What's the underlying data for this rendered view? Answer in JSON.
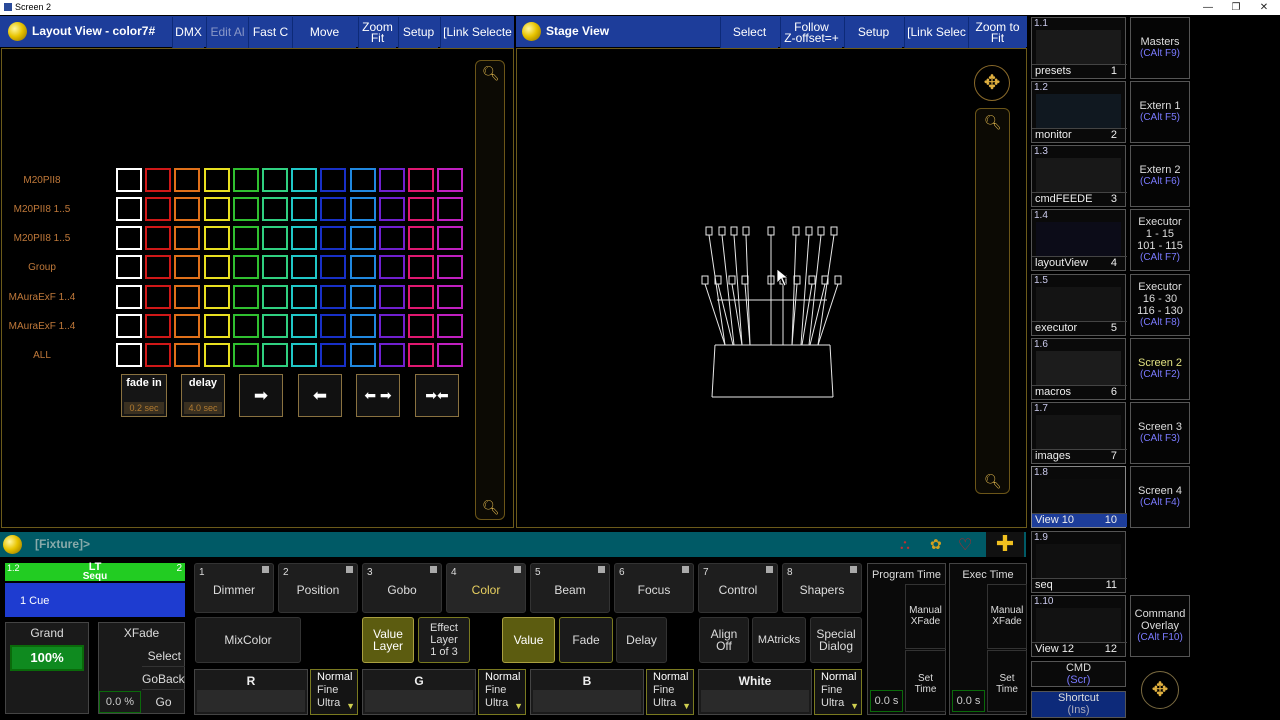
{
  "window": {
    "title": "Screen 2",
    "controls": [
      "—",
      "❐",
      "✕"
    ]
  },
  "layout_view": {
    "title": "Layout View - color7#",
    "buttons": [
      "DMX",
      "Edit Al",
      "Fast C",
      "Move",
      "Zoom\nFit",
      "Setup",
      "[Link Selecte"
    ],
    "row_labels": [
      "M20PII8",
      "M20PII8 1..5",
      "M20PII8 1..5",
      "Group",
      "MAuraExF 1..4",
      "MAuraExF 1..4",
      "ALL"
    ],
    "column_colors": [
      "#ffffff",
      "#d01818",
      "#e0701a",
      "#e8e020",
      "#30c030",
      "#30d080",
      "#20c8c8",
      "#1830c8",
      "#2088e0",
      "#7020d0",
      "#e01870",
      "#c020c0"
    ],
    "fade_label": "fade in",
    "fade_value": "0.2 sec",
    "delay_label": "delay",
    "delay_value": "4.0 sec",
    "arrows": [
      "➡",
      "⬅",
      "⬅ ➡",
      "➡⬅"
    ]
  },
  "stage_view": {
    "title": "Stage View",
    "buttons": [
      "Select",
      "Follow\nZ-offset=+",
      "Setup",
      "[Link Selec",
      "Zoom to\nFit"
    ]
  },
  "viewpool": [
    {
      "num": "1.1",
      "name": "presets",
      "idx": "1"
    },
    {
      "num": "1.2",
      "name": "monitor",
      "idx": "2"
    },
    {
      "num": "1.3",
      "name": "cmdFEEDE",
      "idx": "3"
    },
    {
      "num": "1.4",
      "name": "layoutView",
      "idx": "4"
    },
    {
      "num": "1.5",
      "name": "executor",
      "idx": "5"
    },
    {
      "num": "1.6",
      "name": "macros",
      "idx": "6"
    },
    {
      "num": "1.7",
      "name": "images",
      "idx": "7"
    },
    {
      "num": "1.8",
      "name": "View 10",
      "idx": "10"
    },
    {
      "num": "1.9",
      "name": "seq",
      "idx": "11"
    },
    {
      "num": "1.10",
      "name": "View 12",
      "idx": "12"
    }
  ],
  "cmd_btn": {
    "l1": "CMD",
    "l2": "(Scr)"
  },
  "shortcut_btn": {
    "l1": "Shortcut",
    "l2": "(Ins)"
  },
  "sidebar": [
    {
      "l1": "Masters",
      "l2": "",
      "key": "(CAlt F9)"
    },
    {
      "l1": "Extern 1",
      "l2": "",
      "key": "(CAlt F5)"
    },
    {
      "l1": "Extern 2",
      "l2": "",
      "key": "(CAlt F6)"
    },
    {
      "l1": "Executor",
      "l2": "1 - 15\n101 - 115",
      "key": "(CAlt F7)"
    },
    {
      "l1": "Executor",
      "l2": "16 - 30\n116 - 130",
      "key": "(CAlt F8)"
    },
    {
      "l1": "Screen 2",
      "l2": "",
      "key": "(CAlt F2)"
    },
    {
      "l1": "Screen 3",
      "l2": "",
      "key": "(CAlt F3)"
    },
    {
      "l1": "Screen 4",
      "l2": "",
      "key": "(CAlt F4)"
    }
  ],
  "command_overlay": {
    "l1": "Command\nOverlay",
    "key": "(CAlt F10)"
  },
  "fixture_bar": {
    "text": "[Fixture]>"
  },
  "executor": {
    "num": "1.2",
    "name": "LT",
    "sub": "Sequ",
    "page": "2",
    "cue": "1 Cue",
    "grand_label": "Grand",
    "grand_value": "100%",
    "xfade_label": "XFade",
    "xfade_value": "0.0 %",
    "select": "Select",
    "goback": "GoBack",
    "go": "Go"
  },
  "features": [
    {
      "n": "1",
      "t": "Dimmer"
    },
    {
      "n": "2",
      "t": "Position"
    },
    {
      "n": "3",
      "t": "Gobo"
    },
    {
      "n": "4",
      "t": "Color"
    },
    {
      "n": "5",
      "t": "Beam"
    },
    {
      "n": "6",
      "t": "Focus"
    },
    {
      "n": "7",
      "t": "Control"
    },
    {
      "n": "8",
      "t": "Shapers"
    }
  ],
  "preset_buttons": {
    "mixcolor": "MixColor",
    "value_layer": "Value\nLayer",
    "effect_layer": "Effect\nLayer\n1 of 3",
    "value": "Value",
    "fade": "Fade",
    "delay": "Delay",
    "align": "Align\nOff",
    "matricks": "MAtricks",
    "special": "Special\nDialog"
  },
  "encoders": [
    {
      "t": "R"
    },
    {
      "t": "G"
    },
    {
      "t": "B"
    },
    {
      "t": "White"
    }
  ],
  "encoder_mode": [
    "Normal",
    "Fine",
    "Ultra"
  ],
  "program_time": {
    "label": "Program Time",
    "manual": "Manual\nXFade",
    "set": "Set\nTime",
    "value": "0.0 s"
  },
  "exec_time": {
    "label": "Exec Time",
    "manual": "Manual\nXFade",
    "set": "Set\nTime",
    "value": "0.0 s"
  }
}
